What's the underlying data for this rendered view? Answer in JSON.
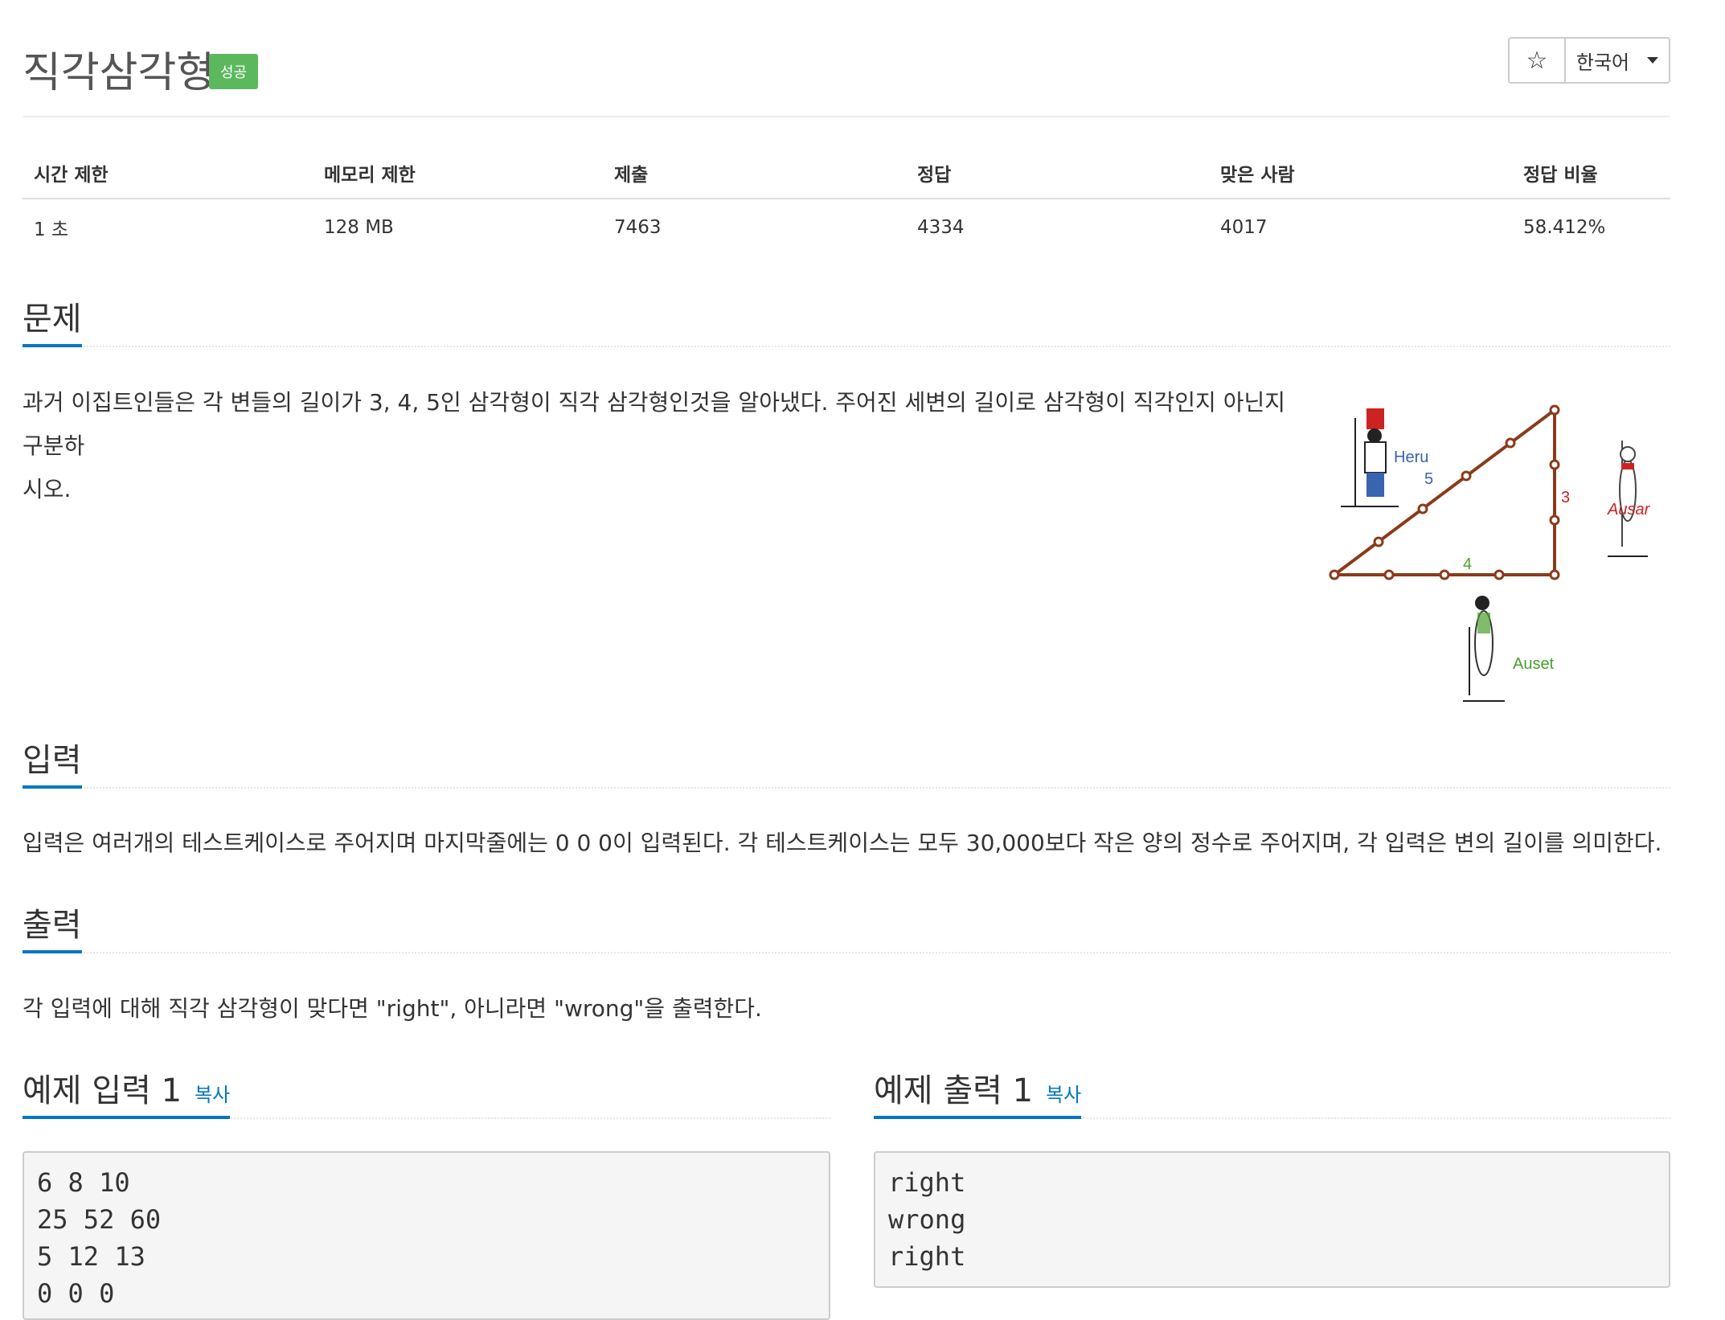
{
  "header": {
    "title": "직각삼각형",
    "badge": "성공",
    "star": "☆",
    "language": "한국어"
  },
  "info_table": {
    "columns": [
      "시간 제한",
      "메모리 제한",
      "제출",
      "정답",
      "맞은 사람",
      "정답 비율"
    ],
    "values": [
      "1 초",
      "128 MB",
      "7463",
      "4334",
      "4017",
      "58.412%"
    ]
  },
  "problem": {
    "heading": "문제",
    "text_line1": "과거 이집트인들은 각 변들의 길이가 3, 4, 5인 삼각형이 직각 삼각형인것을 알아냈다. 주어진 세변의 길이로 삼각형이 직각인지 아닌지 구분하",
    "text_line2": "시오.",
    "figure_labels": {
      "heru": "Heru",
      "ausar": "Ausar",
      "auset": "Auset",
      "side_5": "5",
      "side_3": "3",
      "side_4": "4"
    }
  },
  "input": {
    "heading": "입력",
    "text": "입력은 여러개의 테스트케이스로 주어지며 마지막줄에는 0 0 0이 입력된다. 각 테스트케이스는 모두 30,000보다 작은 양의 정수로 주어지며, 각 입력은 변의 길이를 의미한다."
  },
  "output": {
    "heading": "출력",
    "text": "각 입력에 대해 직각 삼각형이 맞다면 \"right\", 아니라면 \"wrong\"을 출력한다."
  },
  "sample_input": {
    "heading": "예제 입력 1",
    "copy": "복사",
    "lines": [
      "6 8 10",
      "25 52 60",
      "5 12 13",
      "0 0 0"
    ]
  },
  "sample_output": {
    "heading": "예제 출력 1",
    "copy": "복사",
    "lines": [
      "right",
      "wrong",
      "right"
    ]
  },
  "colors": {
    "badge": "#5cb85c",
    "accent": "#0076c0",
    "triangle": "#8b3a1a",
    "heru": "#3a63b0",
    "ausar": "#cc2222",
    "auset": "#4aa02c"
  }
}
